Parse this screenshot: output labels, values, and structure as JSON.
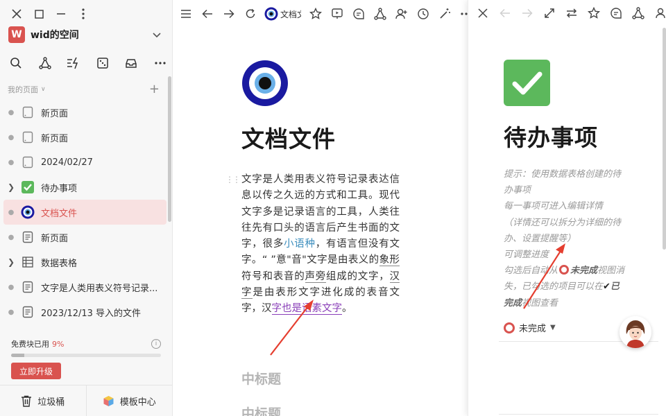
{
  "sidebar": {
    "workspace_initial": "W",
    "workspace_name": "wid的空间",
    "section_label": "我的页面",
    "pages": [
      {
        "label": "新页面",
        "icon": "blank-page-icon"
      },
      {
        "label": "新页面",
        "icon": "blank-page-icon"
      },
      {
        "label": "2024/02/27",
        "icon": "blank-page-icon"
      },
      {
        "label": "待办事项",
        "icon": "green-check-icon",
        "expandable": true
      },
      {
        "label": "文档文件",
        "icon": "nazar-eye-icon",
        "active": true
      },
      {
        "label": "新页面",
        "icon": "doc-page-icon"
      },
      {
        "label": "数据表格",
        "icon": "table-icon",
        "expandable": true
      },
      {
        "label": "文字是人类用表义符号记录...",
        "icon": "doc-page-icon"
      },
      {
        "label": "2023/12/13 导入的文件",
        "icon": "doc-page-icon"
      }
    ],
    "quota_label": "免费块已用",
    "quota_percent_text": "9%",
    "quota_percent": 9,
    "upgrade_label": "立即升级",
    "trash_label": "垃圾桶",
    "templates_label": "模板中心"
  },
  "main": {
    "breadcrumb": "文档文件",
    "title": "文档文件",
    "paragraph": {
      "p1": "文字是人类用表义符号记录表达信息以传之久远的方式和工具。现代文字多是记录语言的工具，人类往往先有口头的语言后产生书面的文字，很多",
      "link": "小语种",
      "p2": "，有语言但没有文字。“ ”意\"音\"文字是由表义的",
      "u1": "象形",
      "p3": "符号和表音的",
      "u2": "声旁",
      "p4": "组成的文字，",
      "u3": "汉字",
      "p5": "是由表形文字进化成的表音文字，汉",
      "purple": "字也是语素文字",
      "p6": "。"
    },
    "heading_1": "中标题",
    "heading_2": "中标题"
  },
  "right": {
    "title": "待办事项",
    "hint": {
      "l1": "提示：使用数据表格创建的待办事项",
      "l2": "每一事项可进入编辑详情",
      "l3": "（详情还可以拆分为详细的待办、设置提醒等）",
      "l4": "可调整进度",
      "l5a": "勾选后自动从",
      "l5b": "未完成",
      "l5c": "视图消失，已勾选的项目可以在",
      "l5d": "已完成",
      "l5e": "视图查看"
    },
    "filter_label": "未完成"
  },
  "colors": {
    "accent": "#d9534f",
    "active_bg": "#f8e1e1",
    "link": "#3b8dbd",
    "purple": "#8a3fb8",
    "check_green": "#5cb85c",
    "eye_blue": "#1a1aa0"
  }
}
